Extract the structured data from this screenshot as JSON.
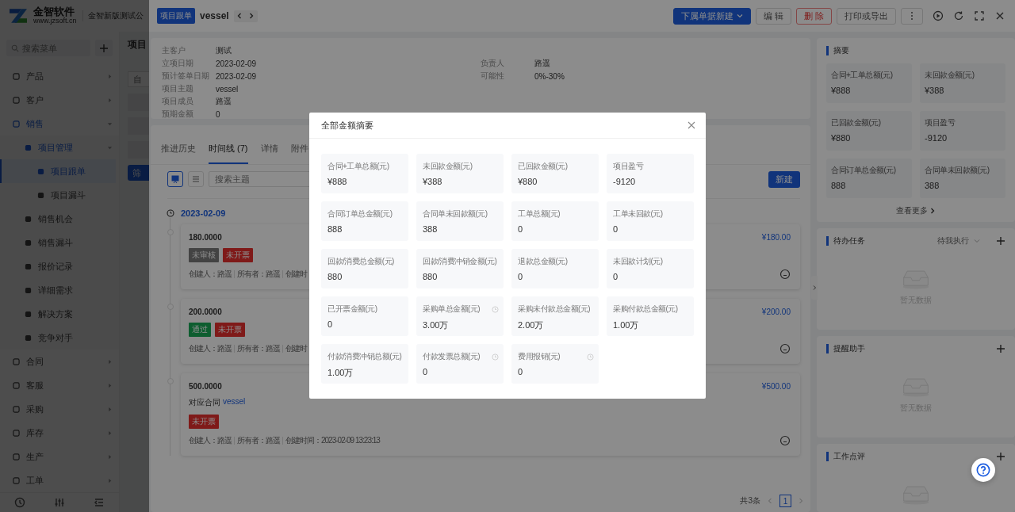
{
  "sidebar": {
    "logo": {
      "name": "金智软件",
      "url": "www.jzsoft.cn"
    },
    "company": "金智新版测试公",
    "search_placeholder": "搜索菜单",
    "menu": [
      {
        "label": "产品",
        "selected": false,
        "expanded": false
      },
      {
        "label": "客户",
        "selected": false,
        "expanded": false
      },
      {
        "label": "销售",
        "selected": false,
        "expanded": true,
        "children": [
          {
            "label": "项目管理",
            "selected": false,
            "expanded": true,
            "children": [
              {
                "label": "项目跟单",
                "selected": true
              },
              {
                "label": "项目漏斗",
                "selected": false
              }
            ]
          },
          {
            "label": "销售机会",
            "selected": false
          },
          {
            "label": "销售漏斗",
            "selected": false
          },
          {
            "label": "报价记录",
            "selected": false
          },
          {
            "label": "详细需求",
            "selected": false
          },
          {
            "label": "解决方案",
            "selected": false
          },
          {
            "label": "竞争对手",
            "selected": false
          }
        ]
      },
      {
        "label": "合同",
        "selected": false,
        "expanded": false
      },
      {
        "label": "客服",
        "selected": false,
        "expanded": false
      },
      {
        "label": "采购",
        "selected": false,
        "expanded": false
      },
      {
        "label": "库存",
        "selected": false,
        "expanded": false
      },
      {
        "label": "生产",
        "selected": false,
        "expanded": false
      },
      {
        "label": "工单",
        "selected": false,
        "expanded": false
      }
    ]
  },
  "background": {
    "title": "项目",
    "field_placeholder": "自",
    "filter_button": "筛"
  },
  "drawer": {
    "tag": "项目跟单",
    "title": "vessel",
    "actions": [
      {
        "label": "下属单据新建",
        "kind": "primary"
      },
      {
        "label": "编 辑",
        "kind": "default"
      },
      {
        "label": "删 除",
        "kind": "danger"
      },
      {
        "label": "打印或导出",
        "kind": "default"
      }
    ]
  },
  "info": {
    "customer": {
      "label": "主客户",
      "value": "测试"
    },
    "left": [
      {
        "label": "立项日期",
        "value": "2023-02-09"
      },
      {
        "label": "预计签单日期",
        "value": "2023-02-09"
      },
      {
        "label": "项目主题",
        "value": "vessel"
      },
      {
        "label": "项目成员",
        "value": "路遥"
      },
      {
        "label": "预期金额",
        "value": "0"
      }
    ],
    "right": [
      {
        "label": "负责人",
        "value": "路遥"
      },
      {
        "label": "可能性",
        "value": "0%-30%"
      }
    ]
  },
  "tabs": [
    {
      "label": "推进历史",
      "selected": false
    },
    {
      "label": "时间线 (7)",
      "selected": true
    },
    {
      "label": "详情",
      "selected": false
    },
    {
      "label": "附件",
      "selected": false
    }
  ],
  "toolbar": {
    "views": [
      {
        "kind": "card",
        "selected": true
      },
      {
        "kind": "list",
        "selected": false
      }
    ],
    "search_placeholder": "搜索主题",
    "new_button": "新建"
  },
  "timeline": {
    "date": "2023-02-09",
    "items": [
      {
        "amount": "180.0000",
        "price": "¥180.00",
        "tags": [
          {
            "label": "未审核",
            "kind": "pending"
          },
          {
            "label": "未开票",
            "kind": "uninvoiced"
          }
        ],
        "meta": [
          "创建人：路遥",
          "所有者：路遥",
          "创建时"
        ]
      },
      {
        "amount": "200.0000",
        "price": "¥200.00",
        "tags": [
          {
            "label": "通过",
            "kind": "approved"
          },
          {
            "label": "未开票",
            "kind": "uninvoiced"
          }
        ],
        "meta": [
          "创建人：路遥",
          "所有者：路遥",
          "创建时"
        ]
      },
      {
        "amount": "500.0000",
        "price": "¥500.00",
        "contract": {
          "label": "对应合同",
          "link": "vessel"
        },
        "tags": [
          {
            "label": "未开票",
            "kind": "uninvoiced"
          }
        ],
        "meta": [
          "创建人：路遥",
          "所有者：路遥",
          "创建时间：2023-02-09 13:23:13"
        ]
      }
    ]
  },
  "pagination": {
    "total": "共3条",
    "pages": [
      {
        "label": "1",
        "selected": true
      }
    ]
  },
  "summary": {
    "title": "摘要",
    "tiles": [
      {
        "label": "合同+工单总额(元)",
        "value": "¥888"
      },
      {
        "label": "未回款金额(元)",
        "value": "¥388"
      },
      {
        "label": "已回款金额(元)",
        "value": "¥880"
      },
      {
        "label": "项目盈亏",
        "value": "-9120"
      },
      {
        "label": "合同订单总金额(元)",
        "value": "888"
      },
      {
        "label": "合同单未回款额(元)",
        "value": "388"
      }
    ],
    "more": "查看更多"
  },
  "panels": [
    {
      "title": "待办任务",
      "filter": "待我执行",
      "empty": "暂无数据"
    },
    {
      "title": "提醒助手",
      "empty": "暂无数据"
    },
    {
      "title": "工作点评"
    }
  ],
  "modal": {
    "title": "全部金额摘要",
    "tiles": [
      {
        "label": "合同+工单总额(元)",
        "value": "¥888",
        "has_tip": false
      },
      {
        "label": "未回款金额(元)",
        "value": "¥388",
        "has_tip": false
      },
      {
        "label": "已回款金额(元)",
        "value": "¥880",
        "has_tip": false
      },
      {
        "label": "项目盈亏",
        "value": "-9120",
        "has_tip": false
      },
      {
        "label": "合同订单总金额(元)",
        "value": "888",
        "has_tip": false
      },
      {
        "label": "合同单未回款额(元)",
        "value": "388",
        "has_tip": false
      },
      {
        "label": "工单总额(元)",
        "value": "0",
        "has_tip": false
      },
      {
        "label": "工单未回款(元)",
        "value": "0",
        "has_tip": false
      },
      {
        "label": "回款/消费总金额(元)",
        "value": "880",
        "has_tip": false
      },
      {
        "label": "回款/消费冲销金额(元)",
        "value": "880",
        "has_tip": false
      },
      {
        "label": "退款总金额(元)",
        "value": "0",
        "has_tip": false
      },
      {
        "label": "未回款计划(元)",
        "value": "0",
        "has_tip": false
      },
      {
        "label": "已开票金额(元)",
        "value": "0",
        "has_tip": false
      },
      {
        "label": "采购单总金额(元)",
        "value": "3.00万",
        "has_tip": true
      },
      {
        "label": "采购未付款总金额(元)",
        "value": "2.00万",
        "has_tip": false
      },
      {
        "label": "采购付款总金额(元)",
        "value": "1.00万",
        "has_tip": false
      },
      {
        "label": "付款/消费冲销总额(元)",
        "value": "1.00万",
        "has_tip": false
      },
      {
        "label": "付款发票总额(元)",
        "value": "0",
        "has_tip": true
      },
      {
        "label": "费用报销(元)",
        "value": "0",
        "has_tip": true
      }
    ]
  }
}
